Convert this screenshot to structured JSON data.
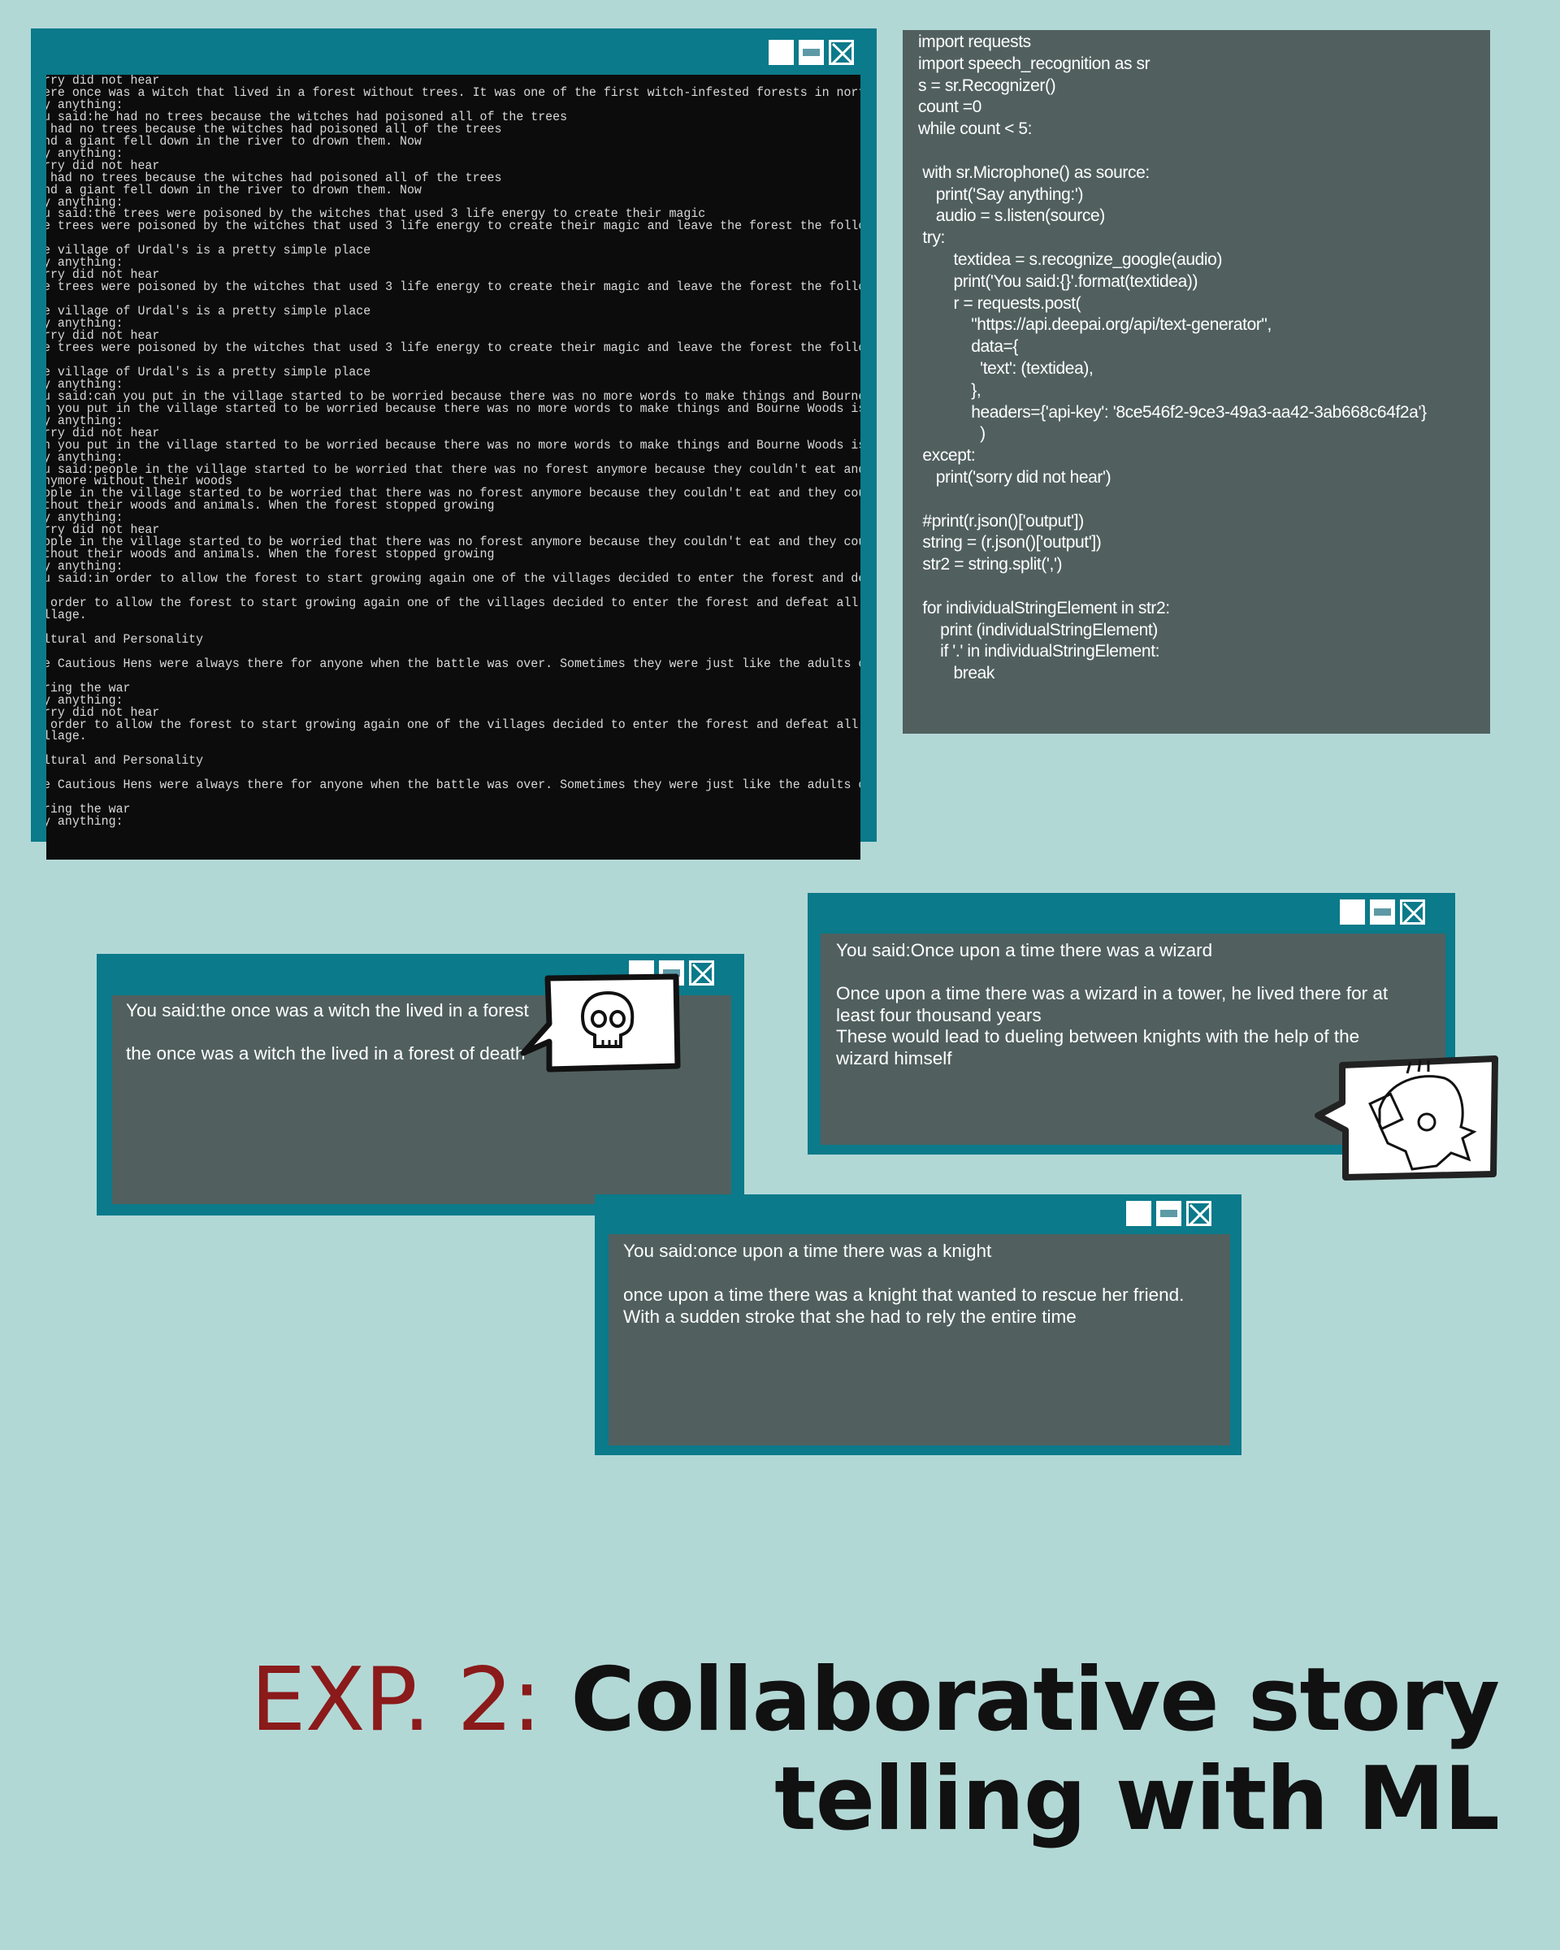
{
  "colors": {
    "background": "#b2d8d6",
    "window_frame": "#0b7a8a",
    "panel": "#51605f",
    "terminal": "#0c0c0c",
    "title_accent": "#8b1a1a"
  },
  "window_controls": [
    "maximize-icon",
    "minimize-icon",
    "close-icon"
  ],
  "terminal": {
    "lines": [
      "rry did not hear",
      "ere once was a witch that lived in a forest without trees. It was one of the first witch-infested forests in northern England. It was",
      "y anything:",
      "u said:he had no trees because the witches had poisoned all of the trees",
      " had no trees because the witches had poisoned all of the trees",
      "nd a giant fell down in the river to drown them. Now",
      "y anything:",
      "rry did not hear",
      " had no trees because the witches had poisoned all of the trees",
      "nd a giant fell down in the river to drown them. Now",
      "y anything:",
      "u said:the trees were poisoned by the witches that used 3 life energy to create their magic",
      "e trees were poisoned by the witches that used 3 life energy to create their magic and leave the forest the following day.",
      "",
      "e village of Urdal's is a pretty simple place",
      "y anything:",
      "rry did not hear",
      "e trees were poisoned by the witches that used 3 life energy to create their magic and leave the forest the following day.",
      "",
      "e village of Urdal's is a pretty simple place",
      "y anything:",
      "rry did not hear",
      "e trees were poisoned by the witches that used 3 life energy to create their magic and leave the forest the following day.",
      "",
      "e village of Urdal's is a pretty simple place",
      "y anything:",
      "u said:can you put in the village started to be worried because there was no more words to make things and Bourne Woods",
      "n you put in the village started to be worried because there was no more words to make things and Bourne Woods is now a quiet place.",
      "y anything:",
      "rry did not hear",
      "n you put in the village started to be worried because there was no more words to make things and Bourne Woods is now a quiet place.",
      "y anything:",
      "u said:people in the village started to be worried that there was no forest anymore because they couldn't eat and they couldn't be warm",
      "nymore without their woods",
      "ople in the village started to be worried that there was no forest anymore because they couldn't eat and they couldn't be warm anymore",
      "thout their woods and animals. When the forest stopped growing",
      "y anything:",
      "rry did not hear",
      "ople in the village started to be worried that there was no forest anymore because they couldn't eat and they couldn't be warm anymore",
      "thout their woods and animals. When the forest stopped growing",
      "y anything:",
      "u said:in order to allow the forest to start growing again one of the villages decided to enter the forest and defeat all of the witche",
      "",
      " order to allow the forest to start growing again one of the villages decided to enter the forest and defeat all of the witches of the",
      "llage.",
      "",
      "ltural and Personality",
      "",
      "e Cautious Hens were always there for anyone when the battle was over. Sometimes they were just like the adults of the villagers.",
      "",
      "ring the war",
      "y anything:",
      "rry did not hear",
      " order to allow the forest to start growing again one of the villages decided to enter the forest and defeat all of the witches of the",
      "llage.",
      "",
      "ltural and Personality",
      "",
      "e Cautious Hens were always there for anyone when the battle was over. Sometimes they were just like the adults of the villagers.",
      "",
      "ring the war",
      "y anything:"
    ]
  },
  "code": {
    "lines": [
      "import requests",
      "import speech_recognition as sr",
      "s = sr.Recognizer()",
      "count =0",
      "while count < 5:",
      "",
      " with sr.Microphone() as source:",
      "    print('Say anything:')",
      "    audio = s.listen(source)",
      " try:",
      "        textidea = s.recognize_google(audio)",
      "        print('You said:{}'.format(textidea))",
      "        r = requests.post(",
      "            \"https://api.deepai.org/api/text-generator\",",
      "            data={",
      "              'text': (textidea),",
      "            },",
      "            headers={'api-key': '8ce546f2-9ce3-49a3-aa42-3ab668c64f2a'}",
      "              )",
      " except:",
      "    print('sorry did not hear')",
      "",
      " #print(r.json()['output'])",
      " string = (r.json()['output'])",
      " str2 = string.split(',')",
      "",
      " for individualStringElement in str2:",
      "     print (individualStringElement)",
      "     if '.' in individualStringElement:",
      "        break"
    ]
  },
  "windows": {
    "witch": {
      "said": "You said:the once was a witch the lived in a forest",
      "output": "the once was a witch the lived in a forest of death",
      "bubble_icon": "skull-icon"
    },
    "wizard": {
      "said": "You said:Once upon a time there was a wizard",
      "output": "Once upon a time there was a wizard in a tower, he lived there for at\nleast four thousand years\nThese would lead to dueling between knights with the help of the\nwizard himself",
      "bubble_icon": "knight-helmet-icon"
    },
    "knight": {
      "said": "You said:once upon a time there was a knight",
      "output": "once upon a time there was a knight that wanted to rescue her friend.\nWith a sudden stroke that she had to rely the entire time"
    }
  },
  "title": {
    "accent": "EXP. 2:",
    "line1": "Collaborative story",
    "line2": "telling with ML"
  }
}
